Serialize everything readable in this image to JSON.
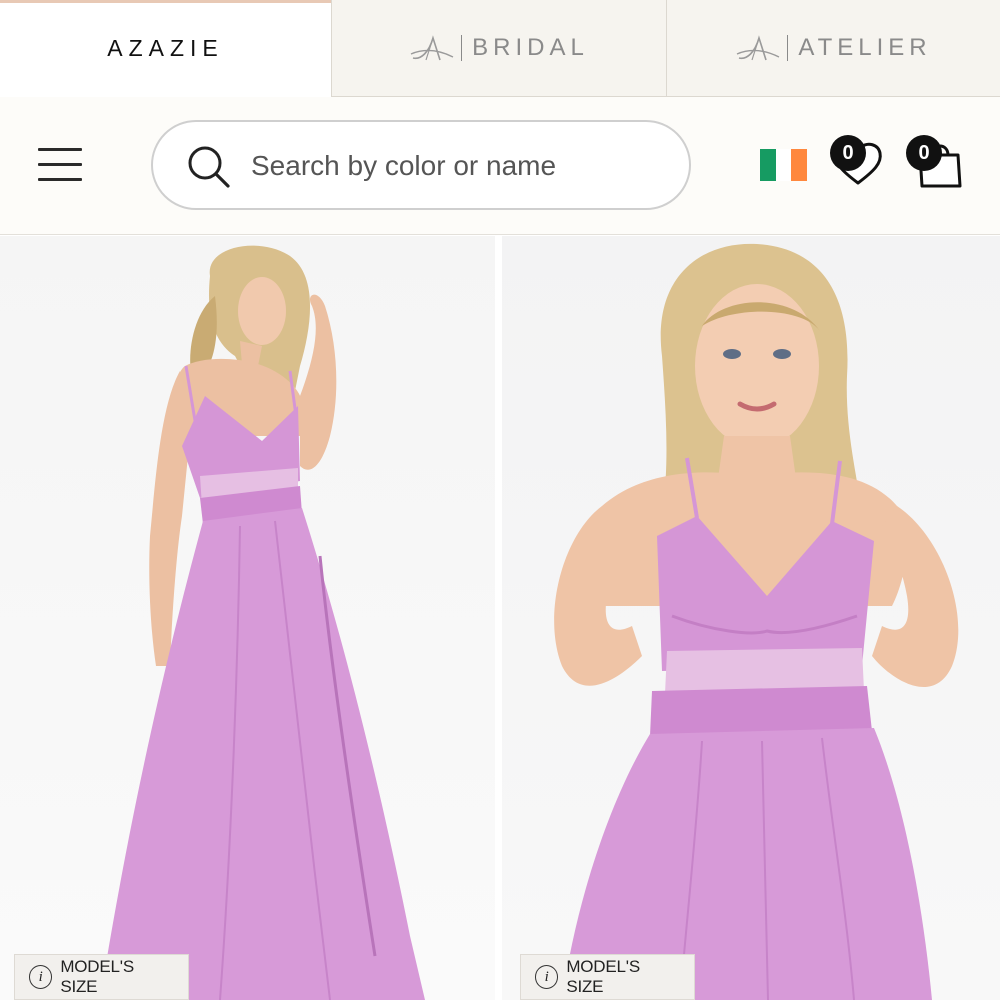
{
  "brand_tabs": [
    {
      "label": "AZAZIE",
      "active": true
    },
    {
      "label": "BRIDAL",
      "active": false
    },
    {
      "label": "ATELIER",
      "active": false
    }
  ],
  "header": {
    "search_placeholder": "Search by color or name",
    "region_flag": "flag-ireland-icon",
    "wishlist_count": "0",
    "cart_count": "0"
  },
  "gallery": {
    "models_size_label": "MODEL'S SIZE",
    "dress_color": "#d79ad8"
  },
  "colors": {
    "flag_green": "#169b62",
    "flag_white": "#ffffff",
    "flag_orange": "#ff883e",
    "active_tab_accent": "#e8c9b5"
  }
}
